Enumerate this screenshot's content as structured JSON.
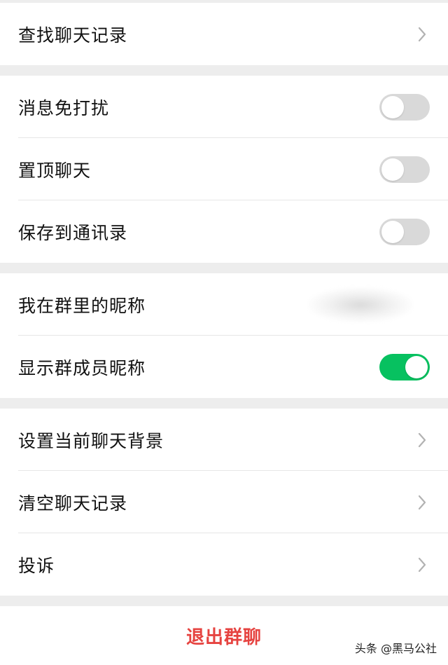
{
  "groups": [
    {
      "rows": [
        {
          "label": "查找聊天记录",
          "control": "chevron"
        }
      ]
    },
    {
      "rows": [
        {
          "label": "消息免打扰",
          "control": "toggle",
          "on": false
        },
        {
          "label": "置顶聊天",
          "control": "toggle",
          "on": false
        },
        {
          "label": "保存到通讯录",
          "control": "toggle",
          "on": false
        }
      ]
    },
    {
      "rows": [
        {
          "label": "我在群里的昵称",
          "control": "blurred-value"
        },
        {
          "label": "显示群成员昵称",
          "control": "toggle",
          "on": true
        }
      ]
    },
    {
      "rows": [
        {
          "label": "设置当前聊天背景",
          "control": "chevron"
        },
        {
          "label": "清空聊天记录",
          "control": "chevron"
        },
        {
          "label": "投诉",
          "control": "chevron"
        }
      ]
    }
  ],
  "exit_label": "退出群聊",
  "watermark": "头条 @黑马公社",
  "colors": {
    "toggle_on": "#07c160",
    "toggle_off": "#d9d9d9",
    "danger": "#e64340"
  }
}
